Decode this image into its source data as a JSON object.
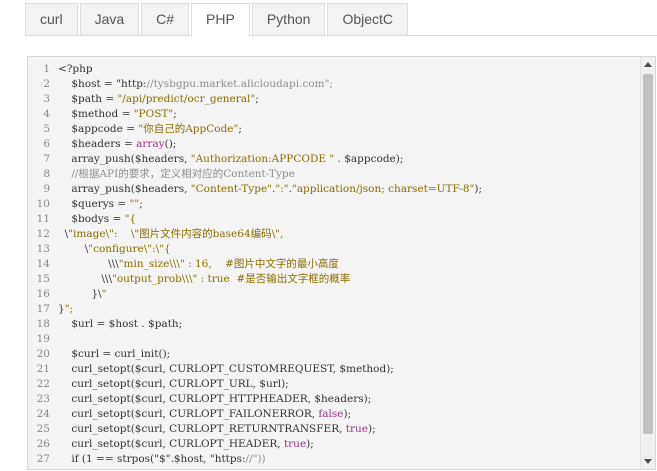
{
  "tabs": [
    {
      "label": "curl",
      "active": false
    },
    {
      "label": "Java",
      "active": false
    },
    {
      "label": "C#",
      "active": false
    },
    {
      "label": "PHP",
      "active": true
    },
    {
      "label": "Python",
      "active": false
    },
    {
      "label": "ObjectC",
      "active": false
    }
  ],
  "code_lines": [
    "<?php",
    "    $host = \"http://tysbgpu.market.alicloudapi.com\";",
    "    $path = \"/api/predict/ocr_general\";",
    "    $method = \"POST\";",
    "    $appcode = \"你自己的AppCode\";",
    "    $headers = array();",
    "    array_push($headers, \"Authorization:APPCODE \" . $appcode);",
    "    //根据API的要求，定义相对应的Content-Type",
    "    array_push($headers, \"Content-Type\".\":\".\"application/json; charset=UTF-8\");",
    "    $querys = \"\";",
    "    $bodys = \"{",
    "  \\\"image\\\":    \\\"图片文件内容的base64编码\\\",",
    "        \\\"configure\\\":\\\"{",
    "               \\\\\\\"min_size\\\\\\\" : 16,    #图片中文字的最小高度",
    "             \\\\\\\"output_prob\\\\\\\" : true  #是否输出文字框的概率",
    "          }\\\"",
    "}\";",
    "    $url = $host . $path;",
    "",
    "    $curl = curl_init();",
    "    curl_setopt($curl, CURLOPT_CUSTOMREQUEST, $method);",
    "    curl_setopt($curl, CURLOPT_URL, $url);",
    "    curl_setopt($curl, CURLOPT_HTTPHEADER, $headers);",
    "    curl_setopt($curl, CURLOPT_FAILONERROR, false);",
    "    curl_setopt($curl, CURLOPT_RETURNTRANSFER, true);",
    "    curl_setopt($curl, CURLOPT_HEADER, true);",
    "    if (1 == strpos(\"$\".$host, \"https://\"))"
  ],
  "colors": {
    "string": "#8a6d00",
    "keyword": "#a0328a",
    "comment": "#8f8f8f",
    "line_number": "#888888",
    "panel_bg": "#f4f4f4"
  }
}
